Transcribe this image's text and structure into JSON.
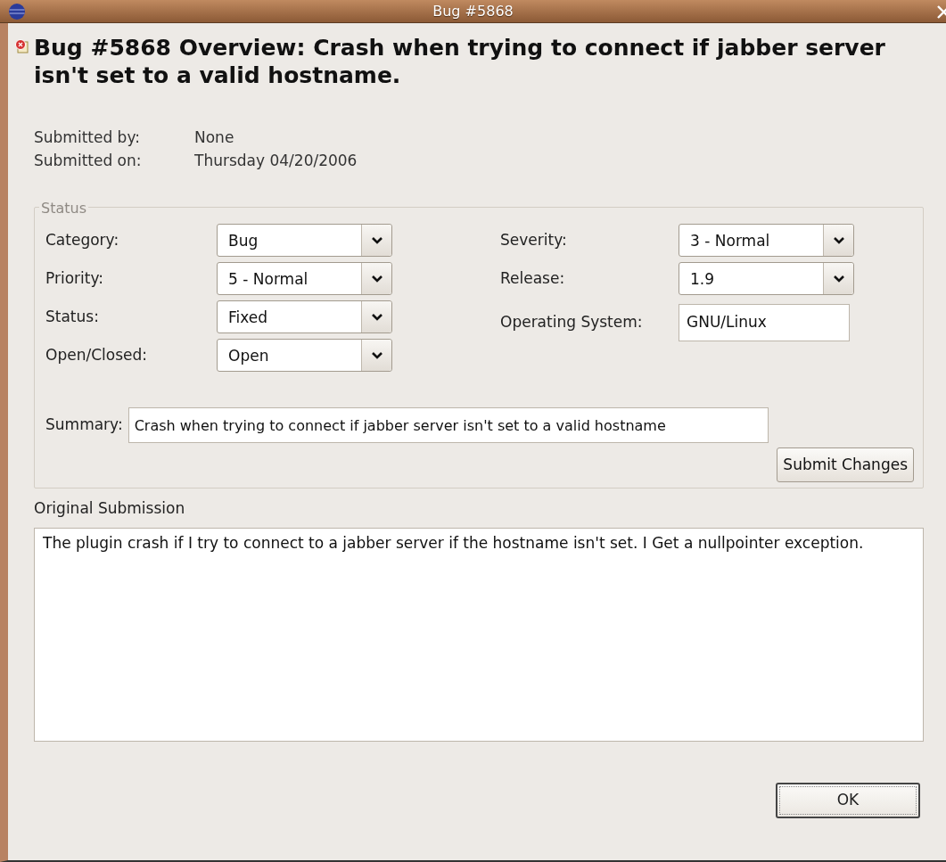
{
  "window": {
    "title": "Bug #5868"
  },
  "heading": "Bug #5868 Overview: Crash when trying to connect if jabber server isn't set to a valid hostname.",
  "submitted": [
    {
      "label": "Submitted by:",
      "value": "None"
    },
    {
      "label": "Submitted on:",
      "value": "Thursday 04/20/2006"
    }
  ],
  "status_group": {
    "legend": "Status",
    "columns": [
      [
        {
          "label": "Category:",
          "kind": "dropdown",
          "value": "Bug"
        },
        {
          "label": "Priority:",
          "kind": "dropdown",
          "value": "5 - Normal"
        },
        {
          "label": "Status:",
          "kind": "dropdown",
          "value": "Fixed"
        },
        {
          "label": "Open/Closed:",
          "kind": "dropdown",
          "value": "Open"
        }
      ],
      [
        {
          "label": "Severity:",
          "kind": "dropdown",
          "value": "3 - Normal"
        },
        {
          "label": "Release:",
          "kind": "dropdown",
          "value": "1.9"
        },
        {
          "label": "Operating System:",
          "kind": "text",
          "value": "GNU/Linux"
        }
      ]
    ],
    "summary": {
      "label": "Summary:",
      "value": "Crash when trying to connect if jabber server isn't set to a valid hostname"
    },
    "submit_button": "Submit Changes"
  },
  "original_submission": {
    "label": "Original Submission",
    "text": "The plugin crash if I try to connect to a jabber server if the hostname isn't set. I Get a nullpointer exception."
  },
  "ok_button": "OK"
}
